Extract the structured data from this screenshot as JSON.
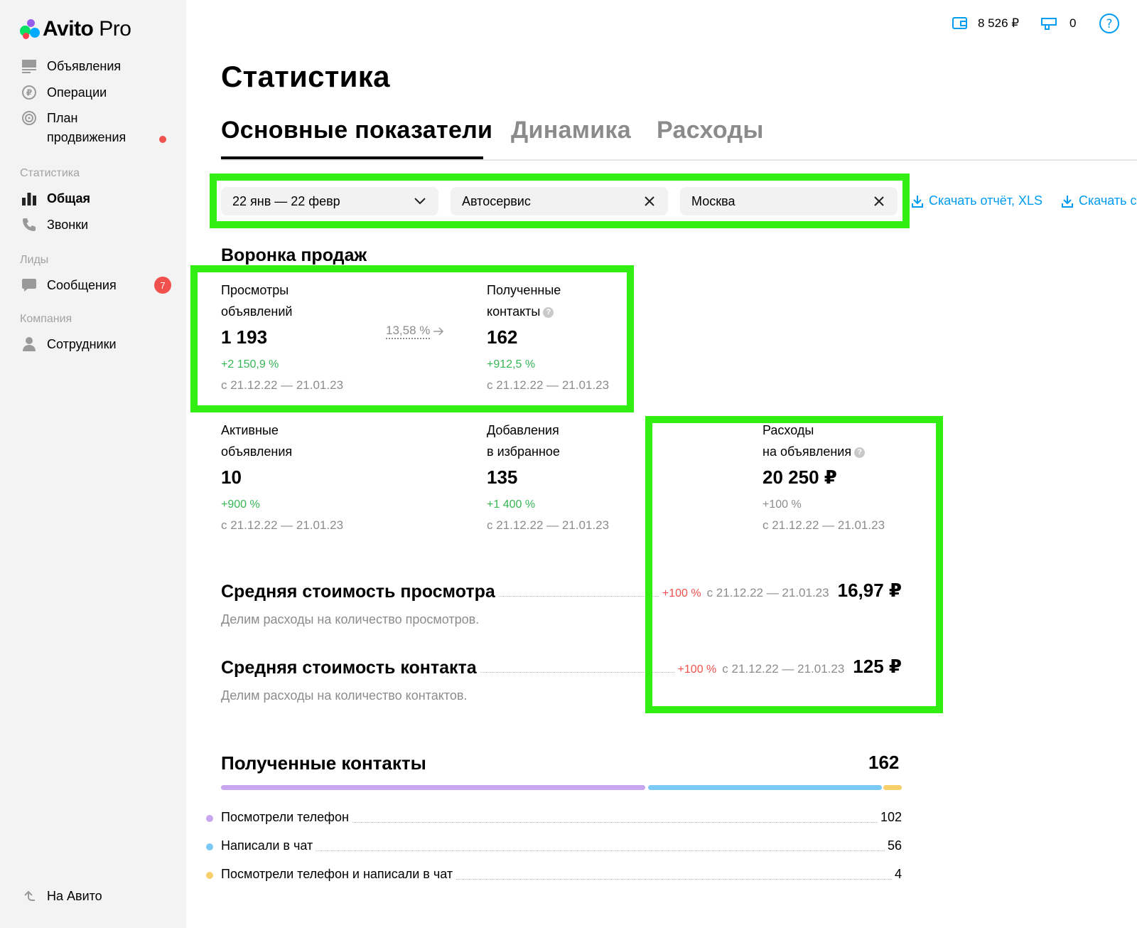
{
  "brand": {
    "name": "Avito",
    "suffix": " Pro"
  },
  "sidebar": {
    "items": [
      {
        "label": "Объявления",
        "icon": "ads-icon"
      },
      {
        "label": "Операции",
        "icon": "operations-icon"
      },
      {
        "label": "План\nпродвижения",
        "icon": "promotion-plan-icon"
      }
    ],
    "sections": {
      "statistics": "Статистика",
      "leads": "Лиды",
      "company": "Компания"
    },
    "stats_items": [
      {
        "label": "Общая",
        "icon": "bar-chart-icon",
        "active": true
      },
      {
        "label": "Звонки",
        "icon": "phone-icon"
      }
    ],
    "lead_items": [
      {
        "label": "Сообщения",
        "icon": "message-icon",
        "badge": "7"
      }
    ],
    "company_items": [
      {
        "label": "Сотрудники",
        "icon": "user-icon"
      }
    ],
    "back_link": "На Авито"
  },
  "topbar": {
    "balance": "8 526 ₽",
    "bonus": "0"
  },
  "page": {
    "title": "Статистика",
    "tabs": [
      "Основные показатели",
      "Динамика",
      "Расходы"
    ]
  },
  "filters": {
    "period": "22 янв — 22 февр",
    "category": "Автосервис",
    "region": "Москва",
    "download_xls": "Скачать отчёт, XLS",
    "download_other": "Скачать с"
  },
  "funnel": {
    "title": "Воронка продаж",
    "conversion": "13,58 %",
    "views": {
      "label1": "Просмотры",
      "label2": "объявлений",
      "value": "1 193",
      "change": "+2 150,9 %",
      "period": "с 21.12.22 — 21.01.23"
    },
    "contacts": {
      "label1": "Полученные",
      "label2": "контакты",
      "value": "162",
      "change": "+912,5 %",
      "period": "с 21.12.22 — 21.01.23"
    },
    "active": {
      "label1": "Активные",
      "label2": "объявления",
      "value": "10",
      "change": "+900 %",
      "period": "с 21.12.22 — 21.01.23"
    },
    "favorites": {
      "label1": "Добавления",
      "label2": "в избранное",
      "value": "135",
      "change": "+1 400 %",
      "period": "с 21.12.22 — 21.01.23"
    },
    "expenses": {
      "label1": "Расходы",
      "label2": "на объявления",
      "value": "20 250 ₽",
      "change": "+100 %",
      "period": "с 21.12.22 — 21.01.23"
    }
  },
  "averages": {
    "view": {
      "title": "Средняя стоимость просмотра",
      "change": "+100 %",
      "period": "с 21.12.22 — 21.01.23",
      "value": "16,97 ₽",
      "desc": "Делим расходы на количество просмотров."
    },
    "contact": {
      "title": "Средняя стоимость контакта",
      "change": "+100 %",
      "period": "с 21.12.22 — 21.01.23",
      "value": "125 ₽",
      "desc": "Делим расходы на количество контактов."
    }
  },
  "contacts_breakdown": {
    "title": "Полученные контакты",
    "total": "162",
    "rows": [
      {
        "label": "Посмотрели телефон",
        "value": "102",
        "color": "#c9a6f0"
      },
      {
        "label": "Написали в чат",
        "value": "56",
        "color": "#7cc9f5"
      },
      {
        "label": "Посмотрели телефон и написали в чат",
        "value": "4",
        "color": "#f7cf6a"
      }
    ]
  },
  "colors": {
    "highlight": "#33ee12",
    "link": "#009cf0",
    "positive": "#36b555",
    "negative": "#f0514c"
  }
}
